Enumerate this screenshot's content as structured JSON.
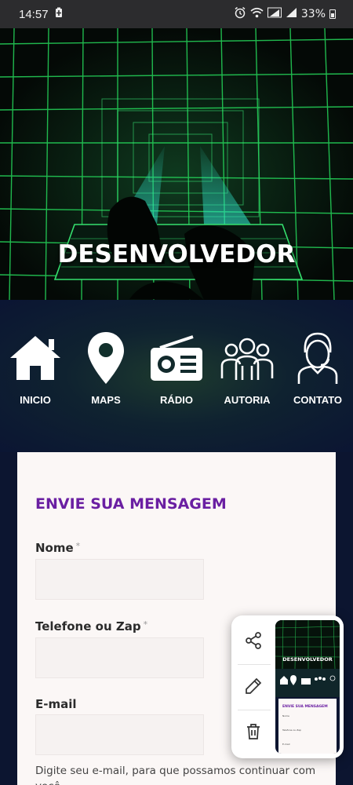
{
  "status_bar": {
    "time": "14:57",
    "battery_percent": "33%",
    "icons": [
      "battery-saver-icon",
      "alarm-icon",
      "wifi-icon",
      "signal-icon",
      "signal-icon",
      "battery-icon"
    ]
  },
  "hero": {
    "title": "DESENVOLVEDOR",
    "accent_color": "#2fe06a"
  },
  "nav": {
    "items": [
      {
        "label": "INICIO",
        "icon": "home-icon"
      },
      {
        "label": "MAPS",
        "icon": "map-pin-icon"
      },
      {
        "label": "RÁDIO",
        "icon": "radio-icon"
      },
      {
        "label": "AUTORIA",
        "icon": "group-icon"
      },
      {
        "label": "CONTATO",
        "icon": "person-icon"
      }
    ]
  },
  "form": {
    "title": "ENVIE SUA MENSAGEM",
    "title_color": "#6a1fa2",
    "required_mark": "*",
    "fields": [
      {
        "label": "Nome",
        "required": true,
        "value": ""
      },
      {
        "label": "Telefone ou Zap",
        "required": true,
        "value": ""
      },
      {
        "label": "E-mail",
        "required": false,
        "value": ""
      }
    ],
    "email_help": "Digite seu e-mail, para que possamos continuar com você."
  },
  "screenshot_toolbar": {
    "actions": [
      "share-icon",
      "edit-icon",
      "delete-icon"
    ],
    "thumbnail": {
      "title": "DESENVOLVEDOR",
      "form_title": "ENVIE SUA MENSAGEM",
      "labels": [
        "Nome",
        "Telefone ou Zap",
        "E-mail"
      ]
    }
  }
}
